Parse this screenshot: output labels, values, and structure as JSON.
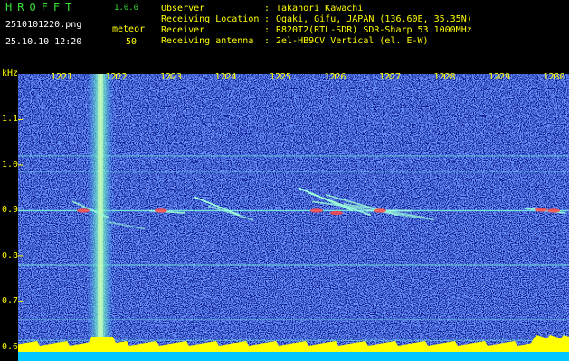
{
  "header": {
    "app_title": "HROFFT",
    "app_version": "1.0.0",
    "file_name": "2510101220.png",
    "datetime": "25.10.10 12:20",
    "mode_label": "meteor",
    "count": "50",
    "info": [
      {
        "key": "Observer",
        "value": "Takanori Kawachi"
      },
      {
        "key": "Receiving Location",
        "value": "Ogaki, Gifu, JAPAN (136.60E, 35.35N)"
      },
      {
        "key": "Receiver",
        "value": "R820T2(RTL-SDR) SDR-Sharp 53.1000MHz"
      },
      {
        "key": "Receiving antenna",
        "value": "2el-HB9CV Vertical (el. E-W)"
      }
    ],
    "separator": ":"
  },
  "chart_data": {
    "type": "heatmap",
    "y_unit": "kHz",
    "y_ticks": [
      "1.1",
      "1.0",
      "0.9",
      "0.8",
      "0.7",
      "0.6"
    ],
    "x_ticks": [
      "1221",
      "1222",
      "1223",
      "1224",
      "1225",
      "1226",
      "1227",
      "1228",
      "1229",
      "1230"
    ],
    "ylim": [
      0.57,
      1.2
    ],
    "colors": {
      "background": "#0c1a90",
      "noise": "#3a5cff",
      "signal": "#7fffd0",
      "strong": "#ff5050",
      "level": "#ffff00",
      "baseline": "#00c8ff"
    }
  }
}
